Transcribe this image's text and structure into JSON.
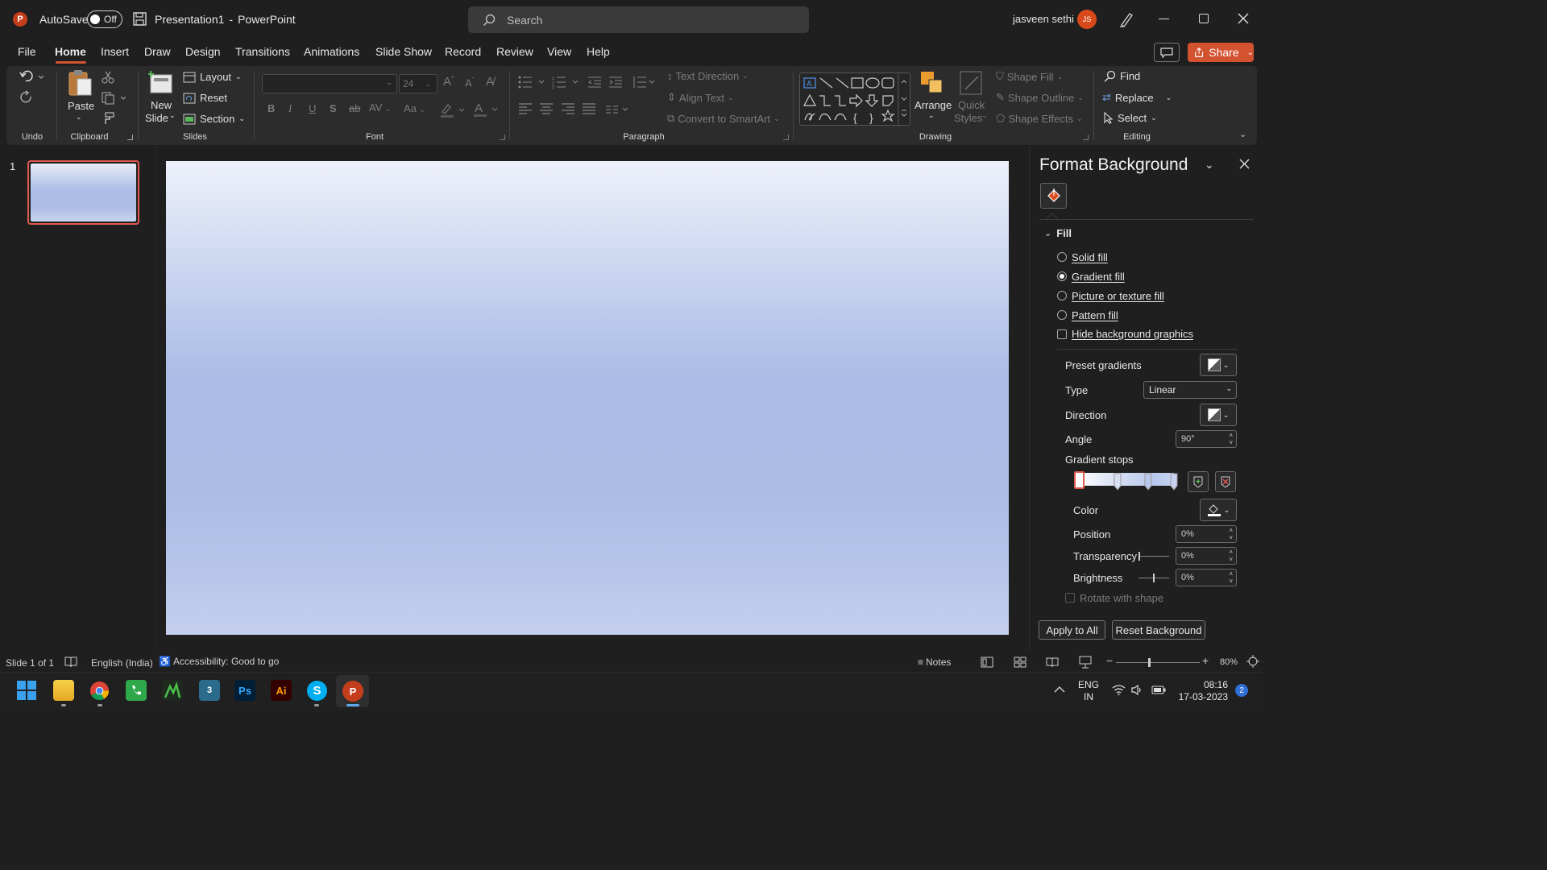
{
  "titlebar": {
    "autosave_label": "AutoSave",
    "autosave_state": "Off",
    "doc_title": "Presentation1",
    "app_sep": "-",
    "app_name": "PowerPoint",
    "search_placeholder": "Search",
    "user_name": "jasveen sethi",
    "user_initials": "JS"
  },
  "menu": {
    "tabs": [
      "File",
      "Home",
      "Insert",
      "Draw",
      "Design",
      "Transitions",
      "Animations",
      "Slide Show",
      "Record",
      "Review",
      "View",
      "Help"
    ],
    "active": "Home",
    "share_label": "Share"
  },
  "ribbon": {
    "groups": {
      "undo": "Undo",
      "clipboard": "Clipboard",
      "slides": "Slides",
      "font": "Font",
      "paragraph": "Paragraph",
      "drawing": "Drawing",
      "editing": "Editing"
    },
    "paste": "Paste",
    "new_slide_1": "New",
    "new_slide_2": "Slide",
    "layout": "Layout",
    "reset": "Reset",
    "section": "Section",
    "font_size": "24",
    "text_direction": "Text Direction",
    "align_text": "Align Text",
    "convert_smartart": "Convert to SmartArt",
    "arrange": "Arrange",
    "quick_styles_1": "Quick",
    "quick_styles_2": "Styles",
    "shape_fill": "Shape Fill",
    "shape_outline": "Shape Outline",
    "shape_effects": "Shape Effects",
    "find": "Find",
    "replace": "Replace",
    "select": "Select"
  },
  "thumbnails": {
    "slide_number": "1"
  },
  "format_pane": {
    "title": "Format Background",
    "section": "Fill",
    "options": {
      "solid": "Solid fill",
      "gradient": "Gradient fill",
      "picture": "Picture or texture fill",
      "pattern": "Pattern fill",
      "hide_graphics": "Hide background graphics"
    },
    "selected_option": "Gradient fill",
    "preset_gradients": "Preset gradients",
    "type_label": "Type",
    "type_value": "Linear",
    "direction_label": "Direction",
    "angle_label": "Angle",
    "angle_value": "90°",
    "gradient_stops_label": "Gradient stops",
    "color_label": "Color",
    "position_label": "Position",
    "position_value": "0%",
    "transparency_label": "Transparency",
    "transparency_value": "0%",
    "brightness_label": "Brightness",
    "brightness_value": "0%",
    "rotate_label": "Rotate with shape",
    "apply_all": "Apply to All",
    "reset_background": "Reset Background"
  },
  "statusbar": {
    "slide_info": "Slide 1 of 1",
    "language": "English (India)",
    "accessibility": "Accessibility: Good to go",
    "notes": "Notes",
    "zoom": "80%"
  },
  "taskbar": {
    "lang_1": "ENG",
    "lang_2": "IN",
    "time": "08:16",
    "date": "17-03-2023",
    "notification_count": "2",
    "ps_label": "Ps",
    "ai_label": "Ai",
    "max_label": "3"
  },
  "colors": {
    "accent": "#d35230",
    "slide_top": "#eef1fa",
    "slide_mid": "#abbde6"
  }
}
